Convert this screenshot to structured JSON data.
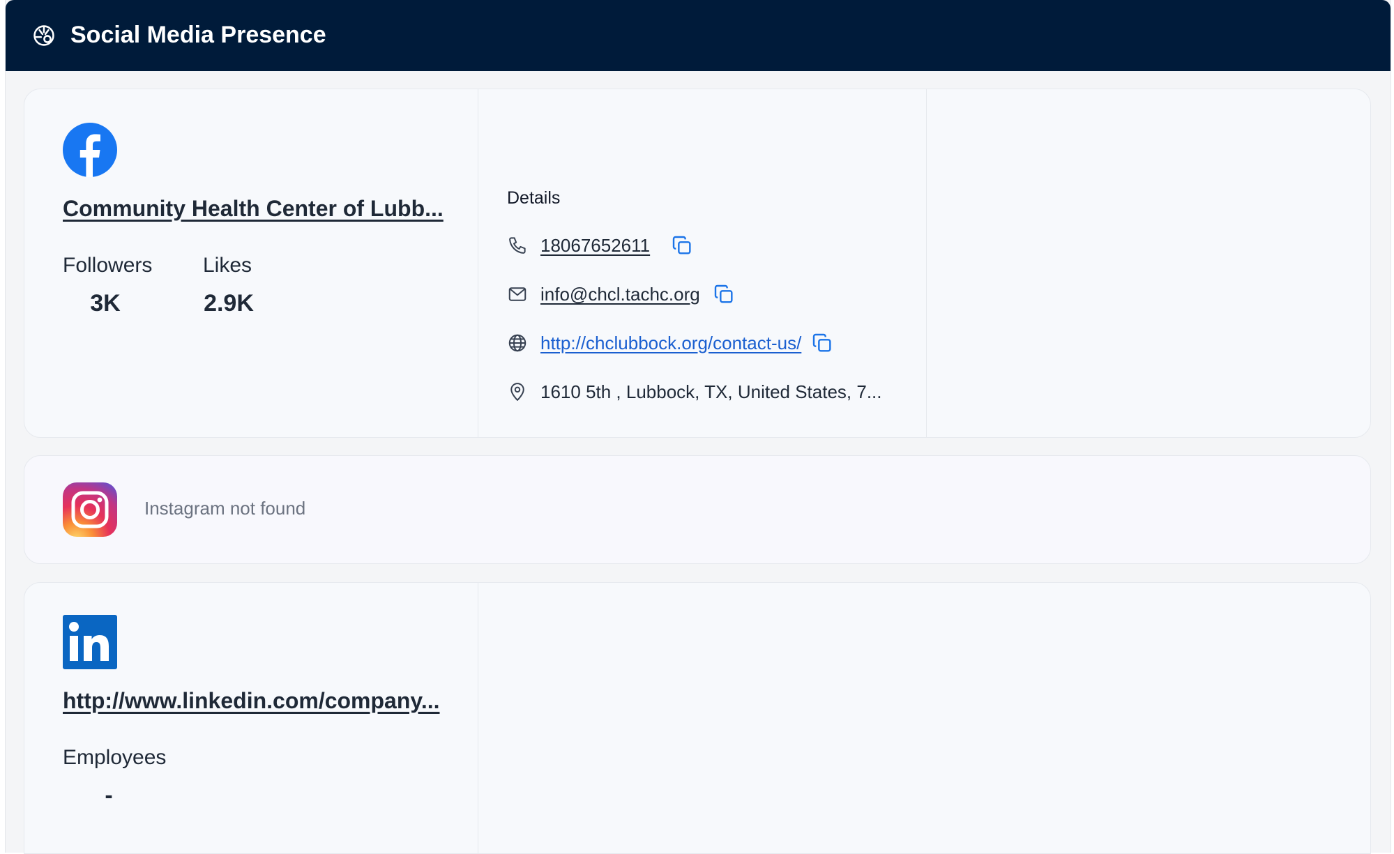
{
  "header": {
    "title": "Social Media Presence",
    "icon": "palette-icon"
  },
  "facebook": {
    "icon": "facebook-icon",
    "brand_color": "#1877f2",
    "profile_name": "Community Health Center of Lubb...",
    "stats": [
      {
        "label": "Followers",
        "value": "3K"
      },
      {
        "label": "Likes",
        "value": "2.9K"
      }
    ],
    "details": {
      "title": "Details",
      "phone": "18067652611",
      "email": "info@chcl.tachc.org",
      "website": "http://chclubbock.org/contact-us/",
      "address": "1610 5th , Lubbock, TX, United States, 7..."
    }
  },
  "instagram": {
    "icon": "instagram-icon",
    "message": "Instagram not found"
  },
  "linkedin": {
    "icon": "linkedin-icon",
    "brand_color": "#0a66c2",
    "profile_url": "http://www.linkedin.com/company...",
    "stats": [
      {
        "label": "Employees",
        "value": "-"
      }
    ]
  },
  "colors": {
    "header_bg": "#001b3a",
    "link": "#1a5fd0",
    "copy_icon": "#1a73e8"
  }
}
